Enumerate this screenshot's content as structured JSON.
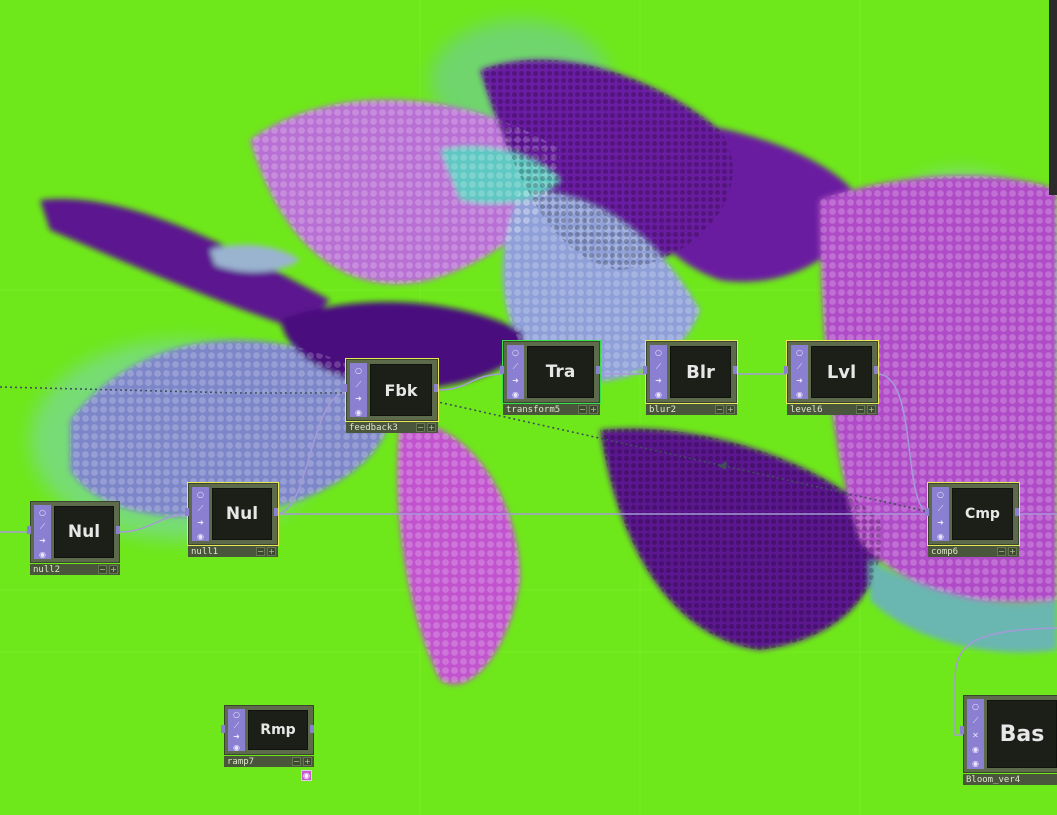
{
  "colors": {
    "background": "#6ee81a",
    "wire": "#a59ad8",
    "node_body": "#5d6a4c",
    "node_strip": "#8a7fd0",
    "selected_outline": "#e9e85a",
    "current_outline": "#39e04a"
  },
  "strip_icons": [
    "circle-icon",
    "wand-icon",
    "arrow-right-icon",
    "eye-icon"
  ],
  "nodes": [
    {
      "id": "null2",
      "short": "Nul",
      "label": "null2",
      "selection": "none"
    },
    {
      "id": "null1",
      "short": "Nul",
      "label": "null1",
      "selection": "yellow"
    },
    {
      "id": "feedback3",
      "short": "Fbk",
      "label": "feedback3",
      "selection": "yellow"
    },
    {
      "id": "transform5",
      "short": "Tra",
      "label": "transform5",
      "selection": "green"
    },
    {
      "id": "blur2",
      "short": "Blr",
      "label": "blur2",
      "selection": "yellow"
    },
    {
      "id": "level6",
      "short": "Lvl",
      "label": "level6",
      "selection": "yellow"
    },
    {
      "id": "comp6",
      "short": "Cmp",
      "label": "comp6",
      "selection": "yellow"
    },
    {
      "id": "ramp7",
      "short": "Rmp",
      "label": "ramp7",
      "selection": "none"
    },
    {
      "id": "bloom_ver4",
      "short": "Bas",
      "label": "Bloom_ver4",
      "selection": "none"
    }
  ],
  "glyphs": {
    "circle": "○",
    "wand": "⟋",
    "arrow": "➜",
    "eye": "◉",
    "plus": "+",
    "dash": "−",
    "x": "✕"
  }
}
